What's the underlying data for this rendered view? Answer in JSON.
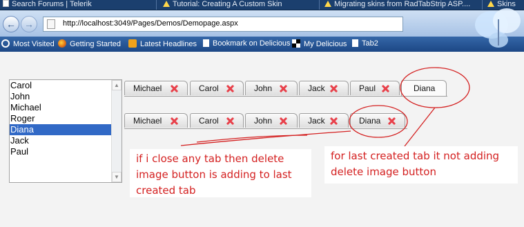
{
  "browser": {
    "tabs": [
      {
        "label": "Search Forums | Telerik",
        "icon": "page-icon"
      },
      {
        "label": "Tutorial: Creating A Custom Skin",
        "icon": "warning-icon"
      },
      {
        "label": "Migrating skins from RadTabStrip ASP....",
        "icon": "warning-icon"
      },
      {
        "label": "Skins",
        "icon": "warning-icon"
      }
    ],
    "url": "http://localhost:3049/Pages/Demos/Demopage.aspx",
    "bookmarks": [
      {
        "label": "Most Visited",
        "icon": "magnifier-icon"
      },
      {
        "label": "Getting Started",
        "icon": "firefox-icon"
      },
      {
        "label": "Latest Headlines",
        "icon": "rss-icon"
      },
      {
        "label": "Bookmark on Delicious",
        "icon": "page-icon"
      },
      {
        "label": "My Delicious",
        "icon": "delicious-icon"
      },
      {
        "label": "Tab2",
        "icon": "page-icon"
      }
    ]
  },
  "listbox": {
    "items": [
      "Carol",
      "John",
      "Michael",
      "Roger",
      "Diana",
      "Jack",
      "Paul"
    ],
    "selected": "Diana"
  },
  "tabstrip_top": [
    "Michael",
    "Carol",
    "John",
    "Jack",
    "Paul",
    "Diana"
  ],
  "tabstrip_bottom": [
    "Michael",
    "Carol",
    "John",
    "Jack",
    "Diana"
  ],
  "annotations": {
    "left_note": [
      "if i close any tab then delete",
      "image button is adding to last",
      "created tab"
    ],
    "right_note": [
      "for last created tab it not adding",
      "delete image button"
    ],
    "color": "#d42020"
  },
  "colors": {
    "selection": "#3169c6",
    "close_x": "#e8404a"
  }
}
